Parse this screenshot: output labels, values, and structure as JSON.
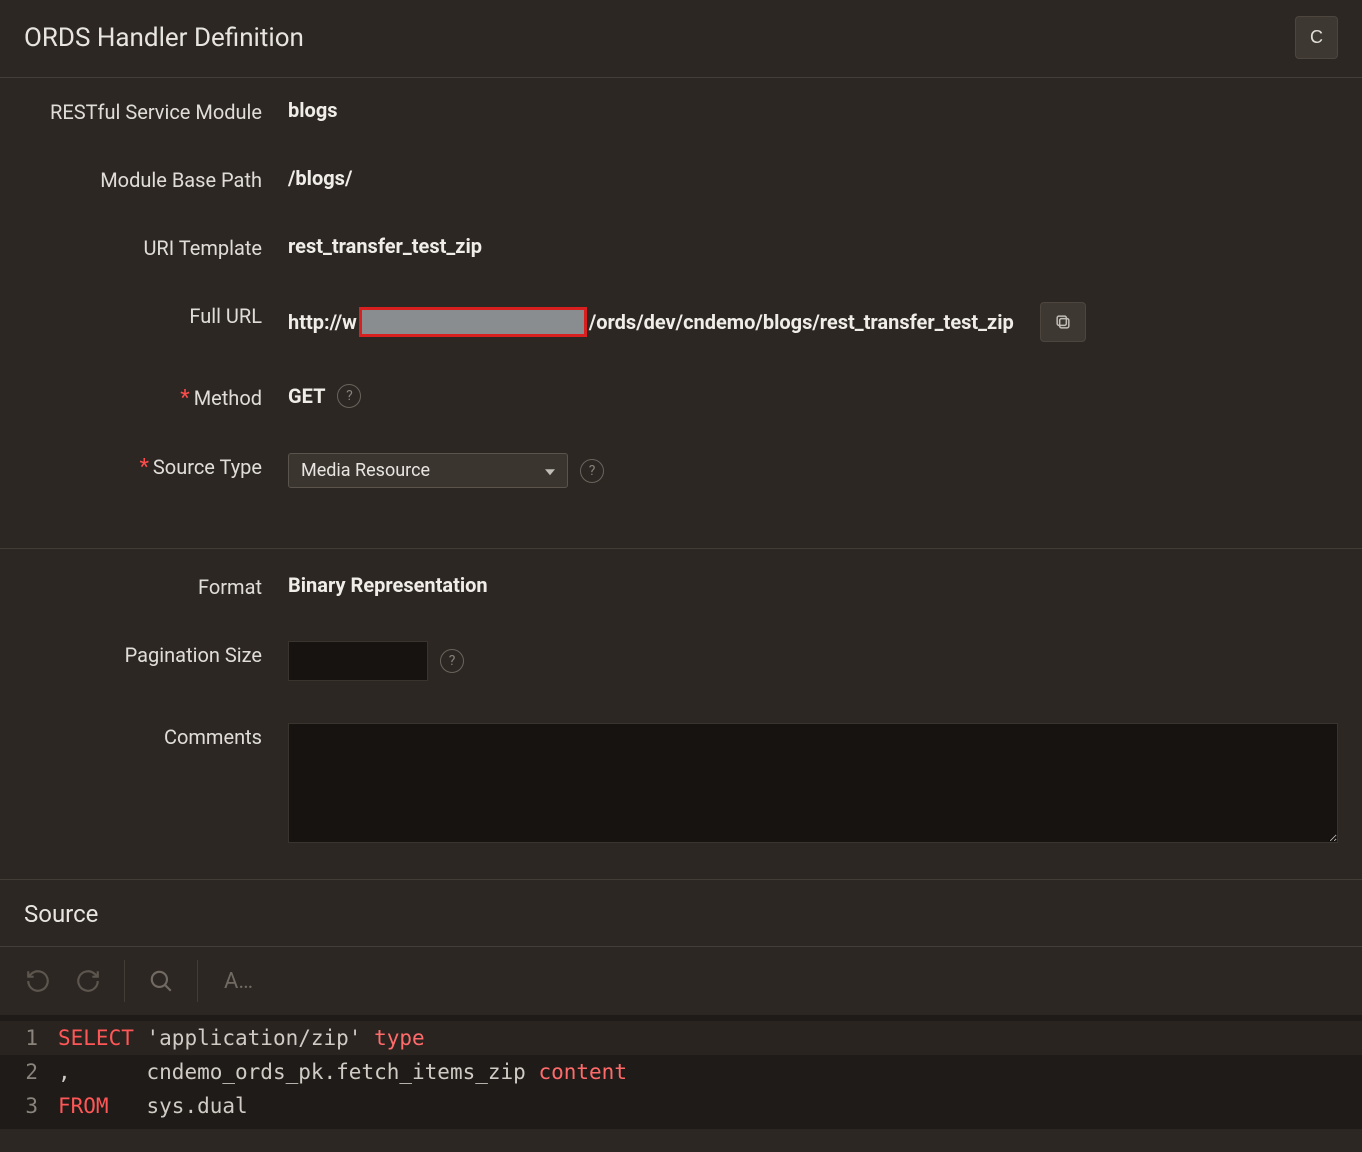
{
  "header": {
    "title": "ORDS Handler Definition",
    "button_label": "C"
  },
  "form": {
    "service_module": {
      "label": "RESTful Service Module",
      "value": "blogs"
    },
    "module_base_path": {
      "label": "Module Base Path",
      "value": "/blogs/"
    },
    "uri_template": {
      "label": "URI Template",
      "value": "rest_transfer_test_zip"
    },
    "full_url": {
      "label": "Full URL",
      "prefix": "http://w",
      "suffix": "/ords/dev/cndemo/blogs/rest_transfer_test_zip"
    },
    "method": {
      "label": "Method",
      "value": "GET",
      "required": true
    },
    "source_type": {
      "label": "Source Type",
      "value": "Media Resource",
      "required": true
    },
    "format": {
      "label": "Format",
      "value": "Binary Representation"
    },
    "pagination_size": {
      "label": "Pagination Size",
      "value": ""
    },
    "comments": {
      "label": "Comments",
      "value": ""
    }
  },
  "source": {
    "title": "Source",
    "code": {
      "line1": {
        "keyword": "SELECT",
        "string": "'application/zip'",
        "alias": "type"
      },
      "line2": {
        "comma": ",",
        "expr": "cndemo_ords_pk.fetch_items_zip",
        "alias": "content"
      },
      "line3": {
        "keyword": "FROM",
        "expr": "sys.dual"
      }
    },
    "toolbar": {
      "font_indicator": "A…"
    }
  }
}
